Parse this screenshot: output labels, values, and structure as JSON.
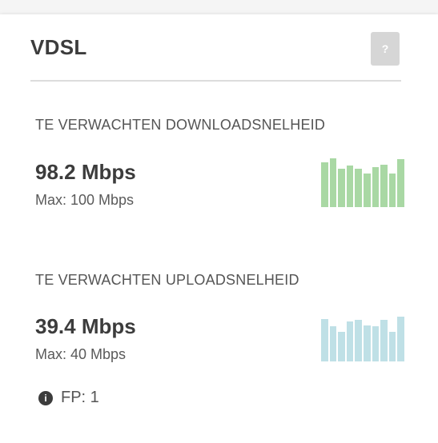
{
  "card": {
    "title": "VDSL",
    "help_label": "?"
  },
  "download": {
    "label": "TE VERWACHTEN DOWNLOADSNELHEID",
    "speed": "98.2 Mbps",
    "max": "Max: 100 Mbps",
    "bar_color": "#a9d8a4",
    "bars": [
      0.92,
      1.0,
      0.79,
      0.85,
      0.79,
      0.69,
      0.82,
      0.87,
      0.69,
      0.98
    ]
  },
  "upload": {
    "label": "TE VERWACHTEN UPLOADSNELHEID",
    "speed": "39.4 Mbps",
    "max": "Max: 40 Mbps",
    "bar_color": "#bfe0e6",
    "bars": [
      0.87,
      0.72,
      0.61,
      0.82,
      0.85,
      0.74,
      0.72,
      0.85,
      0.61,
      0.92
    ]
  },
  "footer": {
    "icon": "info-icon",
    "fp_text": "FP: 1"
  }
}
